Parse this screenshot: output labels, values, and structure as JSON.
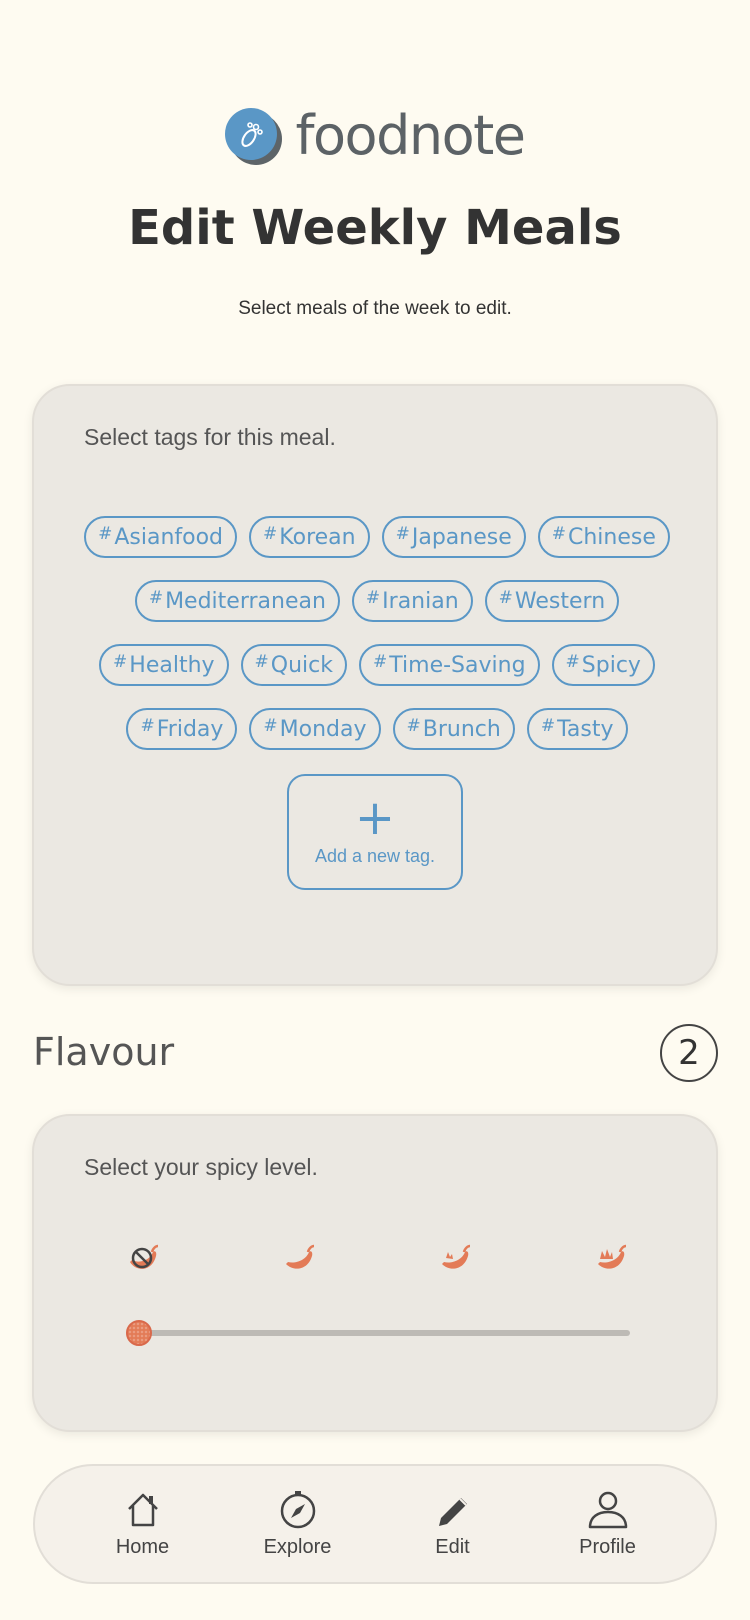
{
  "app": {
    "logo_text": "foodnote"
  },
  "header": {
    "title": "Edit Weekly Meals",
    "subtitle": "Select meals of the week to edit."
  },
  "tags_card": {
    "label": "Select tags for this meal.",
    "rows": [
      [
        "Asianfood",
        "Korean",
        "Japanese",
        "Chinese"
      ],
      [
        "Mediterranean",
        "Iranian",
        "Western"
      ],
      [
        "Healthy",
        "Quick",
        "Time-Saving",
        "Spicy"
      ],
      [
        "Friday",
        "Monday",
        "Brunch",
        "Tasty"
      ]
    ],
    "hash_symbol": "#",
    "add_label": "Add a new tag.",
    "add_icon": "plus-icon"
  },
  "flavour": {
    "title": "Flavour",
    "count": "2",
    "label": "Select your spicy level.",
    "levels": [
      "no-spice-icon",
      "chili-mild-icon",
      "chili-medium-icon",
      "chili-hot-icon"
    ],
    "spicy_level": 0,
    "accent_color": "#e37b57"
  },
  "nav": {
    "items": [
      {
        "label": "Home",
        "icon": "home-icon"
      },
      {
        "label": "Explore",
        "icon": "compass-icon"
      },
      {
        "label": "Edit",
        "icon": "pencil-icon"
      },
      {
        "label": "Profile",
        "icon": "user-icon"
      }
    ]
  },
  "colors": {
    "background": "#fefbf1",
    "card": "#ebe8e2",
    "brand_blue": "#5a97c6",
    "chili_orange": "#e37b57"
  }
}
